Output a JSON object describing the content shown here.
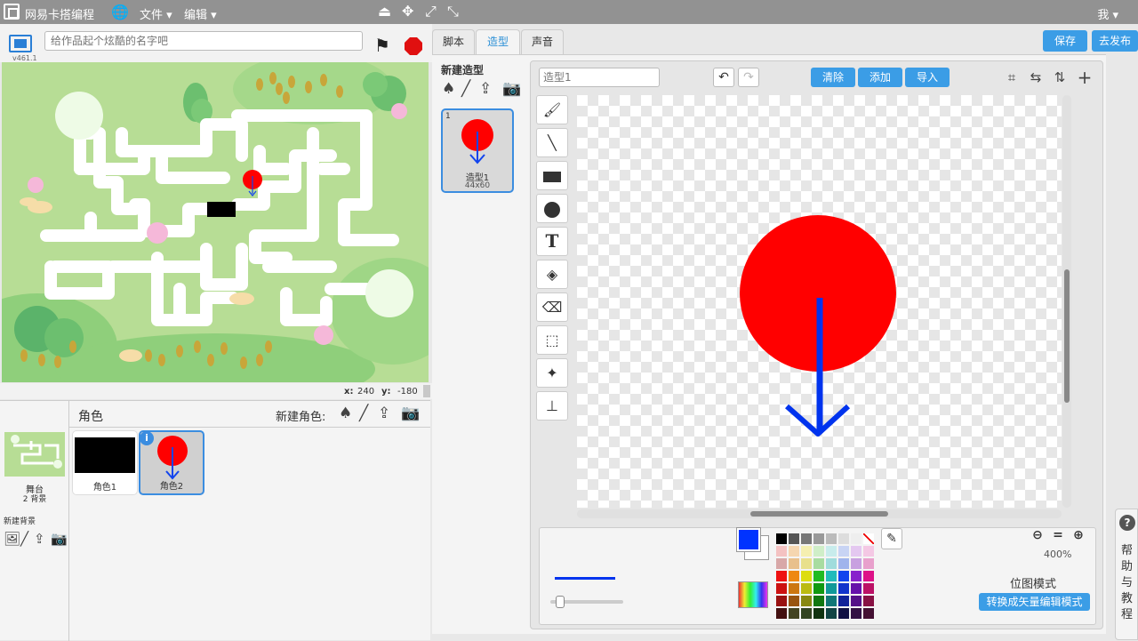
{
  "topbar": {
    "brand": "网易卡搭编程",
    "menu_file": "文件",
    "menu_edit": "编辑",
    "user": "我"
  },
  "stage_header": {
    "title_placeholder": "给作品起个炫酷的名字吧",
    "version": "v461.1"
  },
  "stage_coords": {
    "x_label": "x:",
    "x_value": "240",
    "y_label": "y:",
    "y_value": "-180"
  },
  "sprites_panel": {
    "title": "角色",
    "new_sprite_label": "新建角色:",
    "stage_label": "舞台",
    "stage_backdrops": "2 背景",
    "new_backdrop_label": "新建背景",
    "sprites": [
      {
        "name": "角色1"
      },
      {
        "name": "角色2"
      }
    ]
  },
  "editor_tabs": [
    "脚本",
    "造型",
    "声音"
  ],
  "actions": {
    "save": "保存",
    "publish": "去发布"
  },
  "costumes_panel": {
    "title": "新建造型",
    "costume": {
      "index": "1",
      "name": "造型1",
      "size": "44x60"
    }
  },
  "paint_editor": {
    "costume_name_placeholder": "造型1",
    "clear": "清除",
    "add": "添加",
    "import": "导入",
    "zoom": "400%",
    "mode_label": "位图模式",
    "convert_button": "转换成矢量编辑模式",
    "fill_color": "#0033ff"
  },
  "help": {
    "label": "帮助与教程"
  },
  "colors": {
    "accent": "#3b9de6",
    "stop": "#e01010",
    "sprite_red": "#ff0000",
    "arrow_blue": "#0033ee"
  }
}
